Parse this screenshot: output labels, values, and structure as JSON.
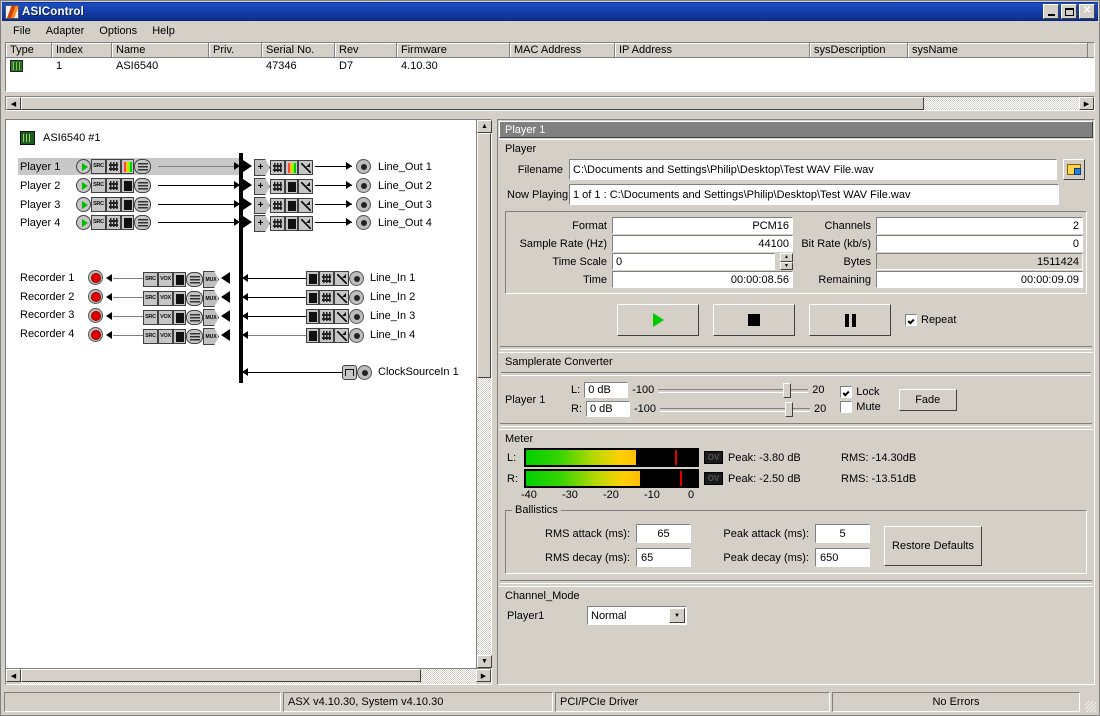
{
  "window": {
    "title": "ASIControl",
    "icon": "app-icon",
    "buttons": {
      "minimize": "–",
      "maximize": "□",
      "close": "✕"
    }
  },
  "menu": {
    "items": [
      "File",
      "Adapter",
      "Options",
      "Help"
    ]
  },
  "adapter_table": {
    "columns": [
      "Type",
      "Index",
      "Name",
      "Priv.",
      "Serial No.",
      "Rev",
      "Firmware",
      "MAC Address",
      "IP Address",
      "sysDescription",
      "sysName"
    ],
    "rows": [
      {
        "type_icon": "adapter-chip-icon",
        "index": "1",
        "name": "ASI6540",
        "priv": "",
        "serial": "47346",
        "rev": "D7",
        "firmware": "4.10.30",
        "mac": "",
        "ip": "",
        "sysDescription": "",
        "sysName": ""
      }
    ]
  },
  "diagram": {
    "device_label": "ASI6540 #1",
    "players": [
      "Player  1",
      "Player  2",
      "Player  3",
      "Player  4"
    ],
    "line_outs": [
      "Line_Out  1",
      "Line_Out  2",
      "Line_Out  3",
      "Line_Out  4"
    ],
    "recorders": [
      "Recorder  1",
      "Recorder  2",
      "Recorder  3",
      "Recorder  4"
    ],
    "line_ins": [
      "Line_In  1",
      "Line_In  2",
      "Line_In  3",
      "Line_In  4"
    ],
    "clock_source": "ClockSourceIn  1",
    "node_icons": {
      "src": "SRC",
      "vox": "VOX",
      "mux": "MUX"
    },
    "selected_row": "Player  1"
  },
  "player_panel": {
    "header": "Player  1",
    "group_label": "Player",
    "filename_label": "Filename",
    "filename_value": "C:\\Documents and Settings\\Philip\\Desktop\\Test WAV File.wav",
    "browse_icon": "open-folder-icon",
    "nowplaying_label": "Now Playing",
    "nowplaying_value": "1 of 1 : C:\\Documents and Settings\\Philip\\Desktop\\Test WAV File.wav",
    "fields_left": [
      {
        "label": "Format",
        "value": "PCM16"
      },
      {
        "label": "Sample Rate (Hz)",
        "value": "44100"
      },
      {
        "label": "Time Scale",
        "value": "0"
      },
      {
        "label": "Time",
        "value": "00:00:08.56"
      }
    ],
    "fields_right": [
      {
        "label": "Channels",
        "value": "2"
      },
      {
        "label": "Bit Rate (kb/s)",
        "value": "0"
      },
      {
        "label": "Bytes",
        "value": "1511424"
      },
      {
        "label": "Remaining",
        "value": "00:00:09.09"
      }
    ],
    "transport": {
      "play": "play-icon",
      "stop": "stop-icon",
      "pause": "pause-icon",
      "repeat_label": "Repeat",
      "repeat_checked": true
    }
  },
  "samplerate_converter": {
    "section_label": "Samplerate Converter",
    "channel_label": "Player  1",
    "left": {
      "prefix": "L:",
      "value": "0 dB",
      "min": "-100",
      "max": "20",
      "position_pct": 83
    },
    "right": {
      "prefix": "R:",
      "value": "0 dB",
      "min": "-100",
      "max": "20",
      "position_pct": 83
    },
    "lock_label": "Lock",
    "lock_checked": true,
    "mute_label": "Mute",
    "mute_checked": false,
    "fade_button": "Fade"
  },
  "meter": {
    "section_label": "Meter",
    "channels": [
      {
        "name": "L:",
        "ov": "OV",
        "peak_label": "Peak: -3.80 dB",
        "rms_label": "RMS: -14.30dB",
        "fill_pct": 63,
        "peak_pct": 86
      },
      {
        "name": "R:",
        "ov": "OV",
        "peak_label": "Peak: -2.50 dB",
        "rms_label": "RMS: -13.51dB",
        "fill_pct": 65,
        "peak_pct": 89
      }
    ],
    "scale": [
      "-40",
      "-30",
      "-20",
      "-10",
      "0"
    ]
  },
  "ballistics": {
    "legend": "Ballistics",
    "rms_attack_label": "RMS attack (ms):",
    "rms_attack_value": "65",
    "rms_decay_label": "RMS decay (ms):",
    "rms_decay_value": "65",
    "peak_attack_label": "Peak attack (ms):",
    "peak_attack_value": "5",
    "peak_decay_label": "Peak decay (ms):",
    "peak_decay_value": "650",
    "restore_button": "Restore Defaults"
  },
  "channel_mode": {
    "section_label": "Channel_Mode",
    "player_label": "Player1",
    "selected": "Normal"
  },
  "statusbar": {
    "left": "",
    "version": "ASX v4.10.30, System v4.10.30",
    "driver": "PCI/PCIe Driver",
    "errors": "No Errors"
  },
  "colors": {
    "titlebar": "#1642ae",
    "face": "#d4d0c8",
    "panel_header": "#808080",
    "play_green": "#00cc00",
    "record_red": "#e40000",
    "peak_red": "#e00000"
  }
}
